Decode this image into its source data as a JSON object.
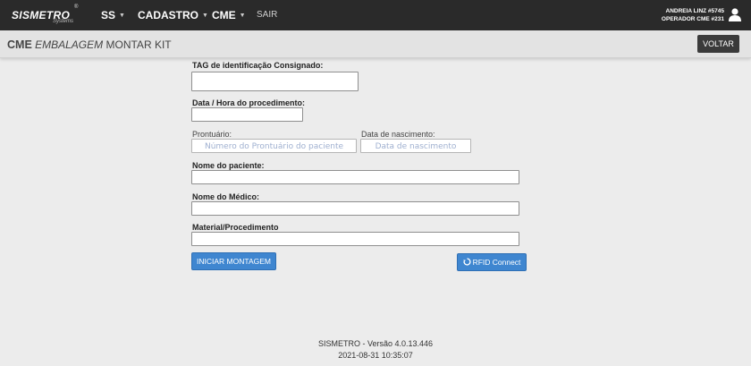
{
  "navbar": {
    "logo_text": "SISMETRO",
    "logo_reg": "®",
    "logo_sub": "Systems",
    "items": [
      {
        "label": "SS",
        "caret": "▼"
      },
      {
        "label": "CADASTRO",
        "caret": "▼"
      },
      {
        "label": "CME",
        "caret": "▼"
      }
    ],
    "logout_label": "SAIR",
    "user_line1": "ANDREIA LINZ #5745",
    "user_line2": "OPERADOR CME #231",
    "user_icon": "user-icon"
  },
  "breadcrumb": {
    "part1": "CME",
    "part2": "EMBALAGEM",
    "part3": "MONTAR KIT"
  },
  "back_button_label": "VOLTAR",
  "form": {
    "tag_label": "TAG de identificação Consignado:",
    "tag_value": "",
    "date_label": "Data / Hora do procedimento:",
    "date_value": "",
    "prontuario_label": "Prontuário:",
    "prontuario_placeholder": "Número do Prontuário do paciente",
    "nascimento_label": "Data de nascimento:",
    "nascimento_placeholder": "Data de nascimento",
    "paciente_label": "Nome do paciente:",
    "paciente_value": "",
    "medico_label": "Nome do Médico:",
    "medico_value": "",
    "material_label": "Material/Procedimento",
    "material_value": "",
    "start_button_label": "INICIAR MONTAGEM",
    "rfid_button_label": "RFID Connect",
    "rfid_icon": "rfid-icon"
  },
  "footer": {
    "version": "SISMETRO - Versão 4.0.13.446",
    "datetime": "2021-08-31 10:35:07"
  },
  "colors": {
    "navbar_bg": "#2a2a2a",
    "page_bg": "#ececec",
    "primary_button": "#3f86d0",
    "back_button": "#3a3a3a"
  }
}
